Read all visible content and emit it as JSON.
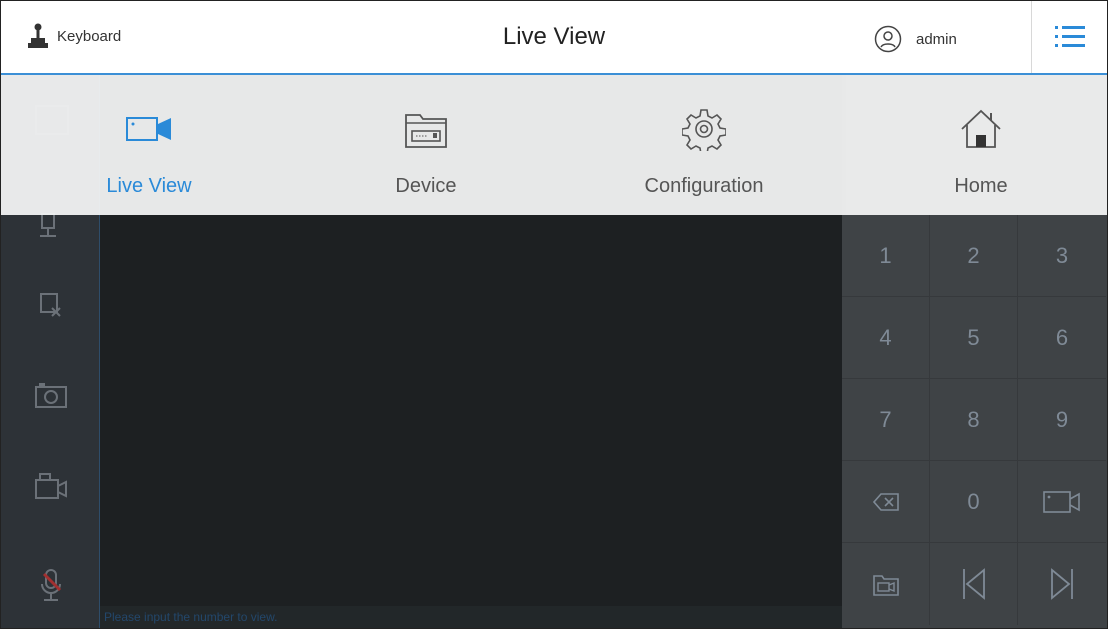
{
  "header": {
    "keyboard_label": "Keyboard",
    "title": "Live View",
    "username": "admin"
  },
  "menu": {
    "items": [
      {
        "label": "Live View",
        "icon": "video-camera-icon",
        "active": true
      },
      {
        "label": "Device",
        "icon": "device-icon"
      },
      {
        "label": "Configuration",
        "icon": "gear-icon"
      },
      {
        "label": "Home",
        "icon": "home-icon"
      }
    ]
  },
  "keypad": {
    "keys": [
      "1",
      "2",
      "3",
      "4",
      "5",
      "6",
      "7",
      "8",
      "9",
      "",
      "0",
      "",
      "",
      "",
      ""
    ]
  },
  "status": {
    "message": "Please input the number to view."
  },
  "colors": {
    "accent": "#2a8ad8",
    "dark_bg": "#2b2f33",
    "video_bg": "#1d2022",
    "keypad_bg": "#3f4346"
  }
}
